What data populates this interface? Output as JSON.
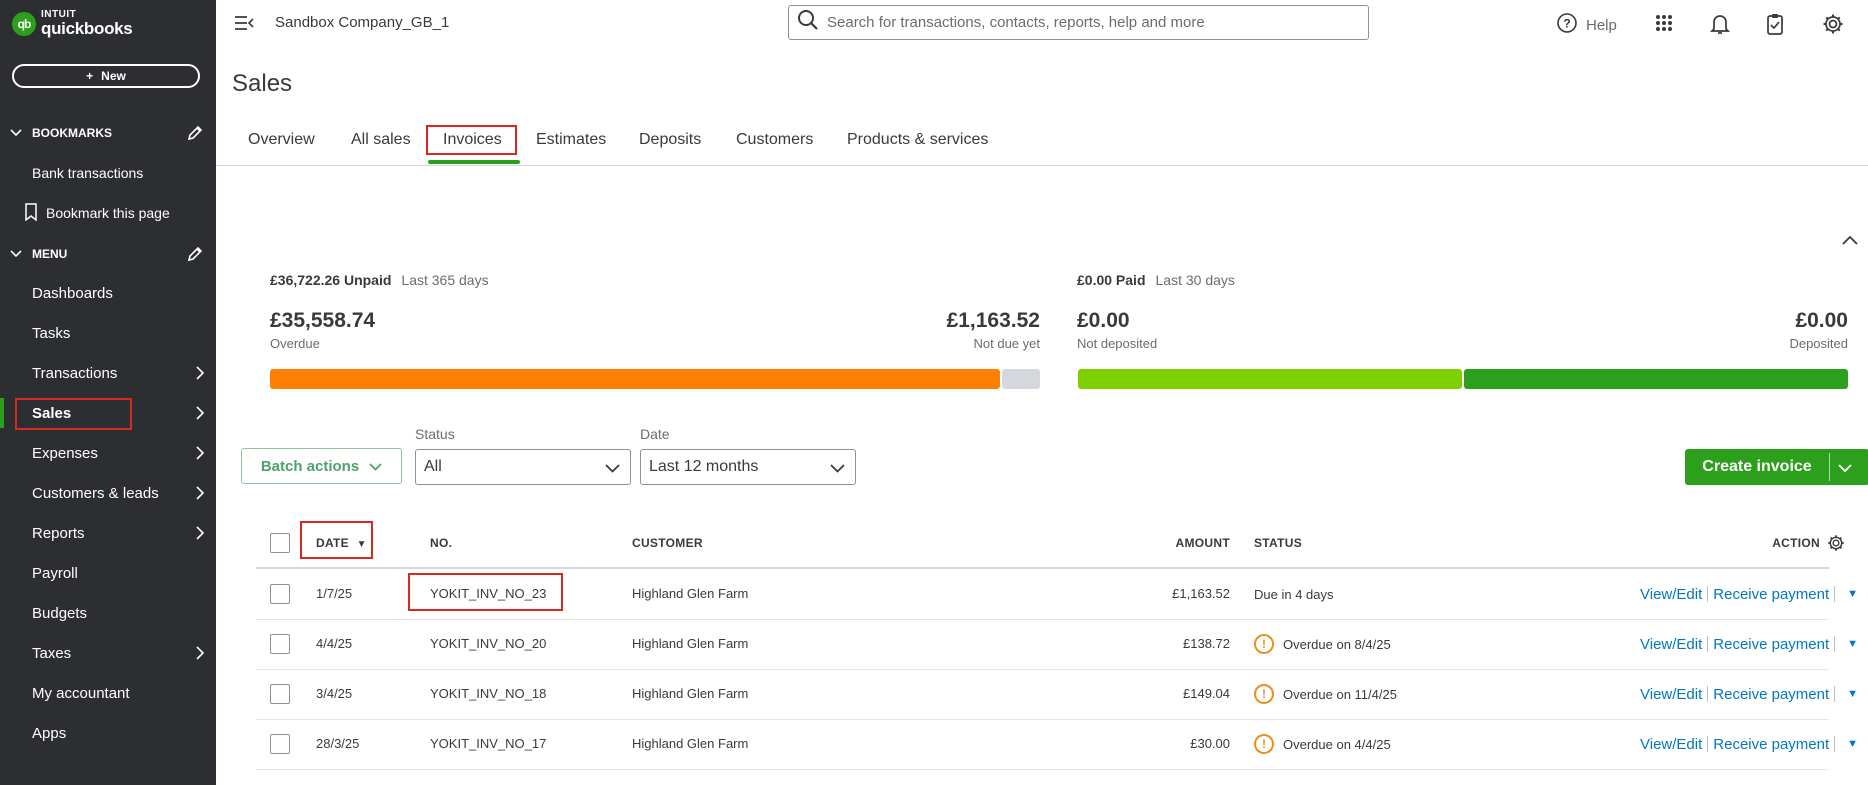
{
  "brand": {
    "intuit": "INTUIT",
    "product": "quickbooks",
    "mark": "qb"
  },
  "sidebar": {
    "new_label": "New",
    "bookmarks_header": "BOOKMARKS",
    "bookmarks": [
      "Bank transactions",
      "Bookmark this page"
    ],
    "menu_header": "MENU",
    "menu_items": [
      {
        "label": "Dashboards",
        "has_arrow": false
      },
      {
        "label": "Tasks",
        "has_arrow": false
      },
      {
        "label": "Transactions",
        "has_arrow": true
      },
      {
        "label": "Sales",
        "has_arrow": true,
        "active": true
      },
      {
        "label": "Expenses",
        "has_arrow": true
      },
      {
        "label": "Customers & leads",
        "has_arrow": true
      },
      {
        "label": "Reports",
        "has_arrow": true
      },
      {
        "label": "Payroll",
        "has_arrow": false
      },
      {
        "label": "Budgets",
        "has_arrow": false
      },
      {
        "label": "Taxes",
        "has_arrow": true
      },
      {
        "label": "My accountant",
        "has_arrow": false
      },
      {
        "label": "Apps",
        "has_arrow": false
      }
    ]
  },
  "topbar": {
    "company": "Sandbox Company_GB_1",
    "search_placeholder": "Search for transactions, contacts, reports, help and more",
    "help_label": "Help"
  },
  "page": {
    "title": "Sales",
    "tabs": [
      "Overview",
      "All sales",
      "Invoices",
      "Estimates",
      "Deposits",
      "Customers",
      "Products & services"
    ],
    "active_tab": "Invoices"
  },
  "summary": {
    "unpaid": {
      "amount": "£36,722.26 Unpaid",
      "period": "Last 365 days",
      "overdue_value": "£35,558.74",
      "overdue_caption": "Overdue",
      "not_due_value": "£1,163.52",
      "not_due_caption": "Not due yet",
      "overdue_fraction": 0.95
    },
    "paid": {
      "amount": "£0.00 Paid",
      "period": "Last 30 days",
      "not_deposited_value": "£0.00",
      "not_deposited_caption": "Not deposited",
      "deposited_value": "£0.00",
      "deposited_caption": "Deposited",
      "not_deposited_fraction": 0.5
    },
    "colors": {
      "overdue": "#ff8000",
      "not_due": "#d4d7dc",
      "not_deposited": "#7fd000",
      "deposited": "#2ca01c"
    }
  },
  "filters": {
    "batch_label": "Batch actions",
    "status_label": "Status",
    "status_value": "All",
    "date_label": "Date",
    "date_value": "Last 12 months",
    "create_label": "Create invoice"
  },
  "table": {
    "columns": {
      "date": "DATE",
      "sort_indicator": "▼",
      "no": "NO.",
      "customer": "CUSTOMER",
      "amount": "AMOUNT",
      "status": "STATUS",
      "action": "ACTION"
    },
    "action_labels": {
      "view": "View/Edit",
      "receive": "Receive payment"
    },
    "rows": [
      {
        "date": "1/7/25",
        "no": "YOKIT_INV_NO_23",
        "customer": "Highland Glen Farm",
        "amount": "£1,163.52",
        "status": "Due in 4 days",
        "overdue": false
      },
      {
        "date": "4/4/25",
        "no": "YOKIT_INV_NO_20",
        "customer": "Highland Glen Farm",
        "amount": "£138.72",
        "status": "Overdue on 8/4/25",
        "overdue": true
      },
      {
        "date": "3/4/25",
        "no": "YOKIT_INV_NO_18",
        "customer": "Highland Glen Farm",
        "amount": "£149.04",
        "status": "Overdue on 11/4/25",
        "overdue": true
      },
      {
        "date": "28/3/25",
        "no": "YOKIT_INV_NO_17",
        "customer": "Highland Glen Farm",
        "amount": "£30.00",
        "status": "Overdue on 4/4/25",
        "overdue": true
      }
    ]
  }
}
